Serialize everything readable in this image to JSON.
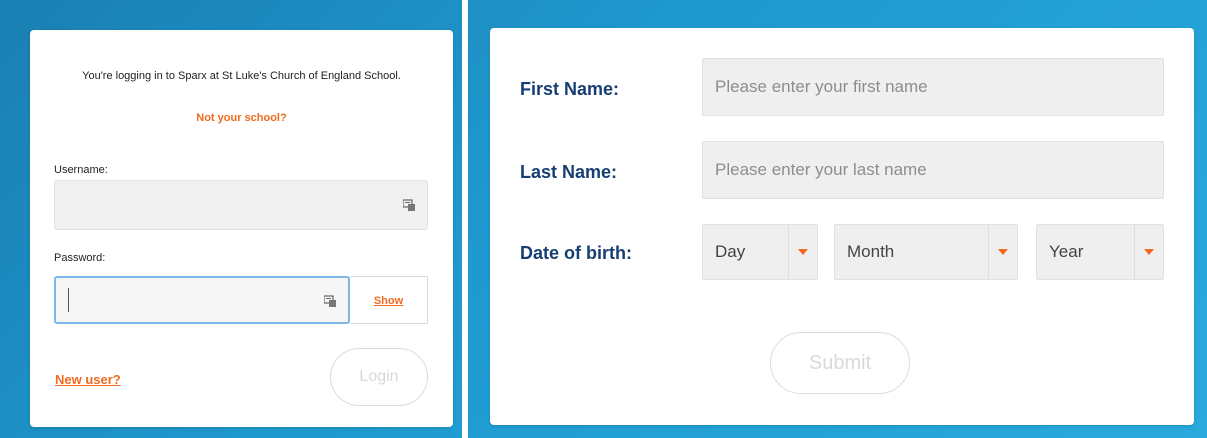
{
  "login": {
    "intro_text": "You're logging in to Sparx at St Luke's Church of England School.",
    "not_your_school": "Not your school?",
    "username_label": "Username:",
    "username_value": "",
    "password_label": "Password:",
    "password_value": "",
    "show_label": "Show",
    "new_user_label": "New user?",
    "login_label": "Login"
  },
  "registration": {
    "first_name_label": "First Name:",
    "first_name_placeholder": "Please enter your first name",
    "last_name_label": "Last Name:",
    "last_name_placeholder": "Please enter your last name",
    "dob_label": "Date of birth:",
    "day_value": "Day",
    "month_value": "Month",
    "year_value": "Year",
    "submit_label": "Submit"
  },
  "colors": {
    "accent_orange": "#f06a1f",
    "label_navy": "#173e73",
    "background_blue": "#1f9ad0"
  },
  "icons": {
    "password_manager": "key-icon",
    "dropdown": "caret-down-icon"
  }
}
